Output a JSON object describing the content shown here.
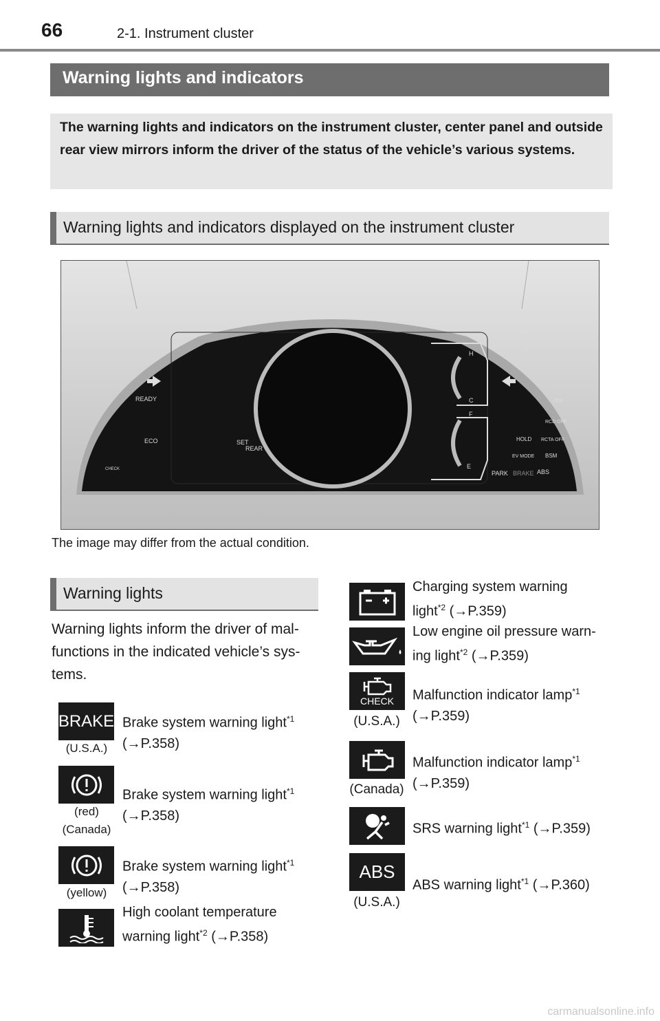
{
  "header": {
    "page_number": "66",
    "section": "2-1. Instrument cluster"
  },
  "title": "Warning lights and indicators",
  "intro": "The warning lights and indicators on the instrument cluster, center panel and outside rear view mirrors inform the driver of the status of the vehicle’s various systems.",
  "subheading": "Warning lights and indicators displayed on the instrument cluster",
  "cluster_labels": [
    "READY",
    "ECO",
    "SET",
    "REAR",
    "H",
    "C",
    "F",
    "E",
    "OFF",
    "RCD OFF",
    "HOLD",
    "RCTA OFF",
    "EV MODE",
    "BSM",
    "PARK",
    "BRAKE",
    "ABS",
    "CHECK"
  ],
  "caption": "The image may differ from the actual condition.",
  "warning_heading": "Warning lights",
  "warning_body": "Warning lights inform the driver of mal-functions in the indicated vehicle’s sys-tems.",
  "left_items": [
    {
      "icon": "brake-text-icon",
      "icon_text": "BRAKE",
      "region": "(U.S.A.)",
      "label": "Brake system warning light",
      "note": "*1",
      "ref": "(→P.358)"
    },
    {
      "icon": "brake-circle-icon",
      "region": "(red)",
      "region2": "(Canada)",
      "label": "Brake system warning light",
      "note": "*1",
      "ref": "(→P.358)"
    },
    {
      "icon": "brake-circle-icon",
      "region": "(yellow)",
      "label": "Brake system warning light",
      "note": "*1",
      "ref": "(→P.358)"
    },
    {
      "icon": "coolant-temperature-icon",
      "label": "High coolant temperature warning light",
      "note": "*2",
      "ref": "(→P.358)"
    }
  ],
  "right_items": [
    {
      "icon": "battery-icon",
      "label": "Charging system warning light",
      "note": "*2",
      "ref": "(→P.359)"
    },
    {
      "icon": "oil-can-icon",
      "label": "Low engine oil pressure warn-ing light",
      "note": "*2",
      "ref": "(→P.359)"
    },
    {
      "icon": "engine-check-icon",
      "icon_text": "CHECK",
      "region": "(U.S.A.)",
      "label": "Malfunction indicator lamp",
      "note": "*1",
      "ref": "(→P.359)"
    },
    {
      "icon": "engine-icon",
      "region": "(Canada)",
      "label": "Malfunction indicator lamp",
      "note": "*1",
      "ref": "(→P.359)"
    },
    {
      "icon": "airbag-icon",
      "label": "SRS warning light",
      "note": "*1",
      "ref": "(→P.359)"
    },
    {
      "icon": "abs-text-icon",
      "icon_text": "ABS",
      "region": "(U.S.A.)",
      "label": "ABS warning light",
      "note": "*1",
      "ref": "(→P.360)"
    }
  ],
  "watermark": "carmanualsonline.info",
  "colors": {
    "heading_bg": "#6e6e6e",
    "intro_bg": "#e6e6e6",
    "icon_bg": "#1b1b1b"
  }
}
